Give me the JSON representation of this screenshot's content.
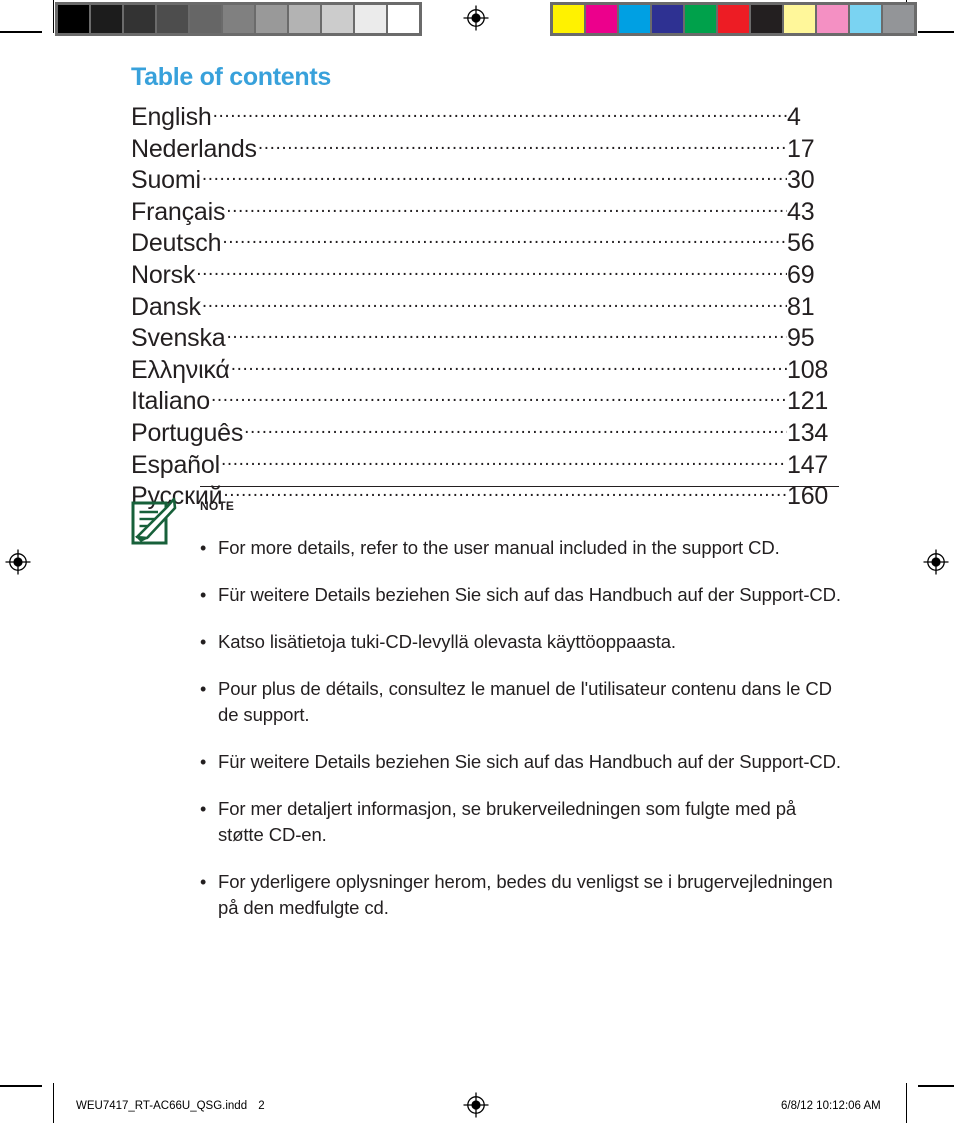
{
  "document": {
    "title": "Table of contents",
    "accent_color": "#38a1db",
    "text_color": "#231f20",
    "note_green": "#17603a"
  },
  "toc": {
    "heading": "Table of contents",
    "dot_leader": "..................................................................................................................",
    "entries": [
      {
        "language": "English",
        "page": "4"
      },
      {
        "language": "Nederlands",
        "page": "17"
      },
      {
        "language": "Suomi",
        "page": "30"
      },
      {
        "language": "Français",
        "page": "43"
      },
      {
        "language": "Deutsch",
        "page": "56"
      },
      {
        "language": "Norsk",
        "page": "69"
      },
      {
        "language": "Dansk",
        "page": "81"
      },
      {
        "language": "Svenska",
        "page": "95"
      },
      {
        "language": "Ελληνικά",
        "page": "108"
      },
      {
        "language": "Italiano",
        "page": "121"
      },
      {
        "language": "Português",
        "page": "134"
      },
      {
        "language": "Español",
        "page": "147"
      },
      {
        "language": "Русский",
        "page": "160"
      }
    ]
  },
  "note": {
    "label": "NOTE",
    "icon": "note-pencil-icon",
    "bullet_glyph": "•",
    "items": [
      "For more details, refer to the user manual included in the support CD.",
      "Für weitere Details beziehen Sie sich auf das Handbuch auf der Support-CD.",
      "Katso lisätietoja tuki-CD-levyllä olevasta käyttöoppaasta.",
      "Pour plus de détails, consultez le manuel de l'utilisateur contenu dans le CD de support.",
      "Für weitere Details beziehen Sie sich auf das Handbuch auf der Support-CD.",
      "For mer detaljert informasjon, se brukerveiledningen som fulgte med på støtte CD-en.",
      "For yderligere oplysninger herom, bedes du venligst se i brugervejledningen på den medfulgte cd."
    ]
  },
  "print_marks": {
    "grayscale_patches": [
      "#000000",
      "#1c1c1c",
      "#333333",
      "#4d4d4d",
      "#666666",
      "#808080",
      "#999999",
      "#b3b3b3",
      "#cccccc",
      "#ebebeb",
      "#ffffff"
    ],
    "color_patches": [
      "#fff200",
      "#ec008c",
      "#00a0e3",
      "#2e3192",
      "#00a14b",
      "#ed1c24",
      "#231f20",
      "#fff79a",
      "#f490c3",
      "#7ad3f2",
      "#939598"
    ],
    "registration_icon": "registration-target-icon"
  },
  "footer": {
    "filename": "WEU7417_RT-AC66U_QSG.indd",
    "page_number": "2",
    "timestamp": "6/8/12   10:12:06 AM"
  }
}
